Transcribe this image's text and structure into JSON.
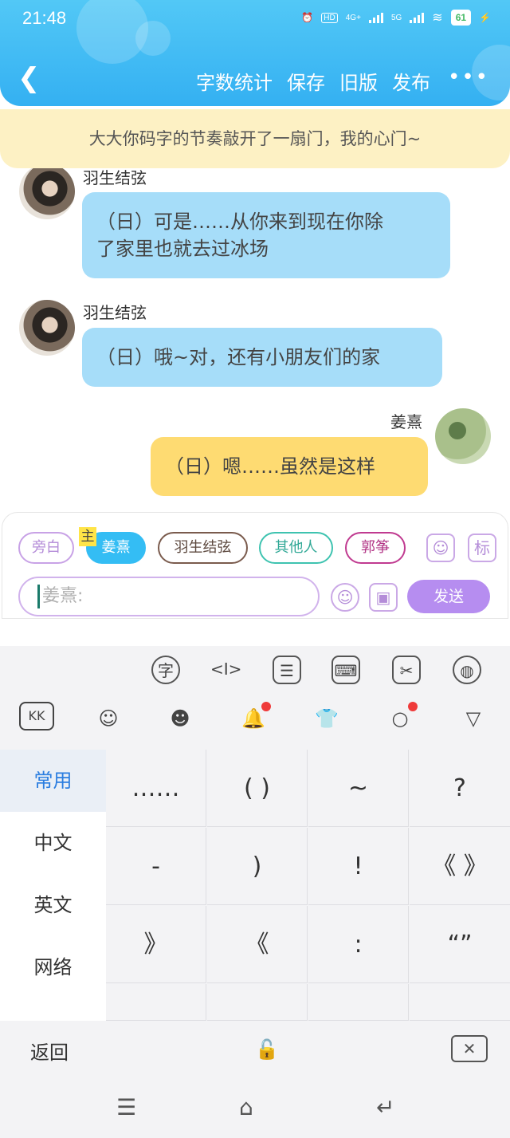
{
  "status_bar": {
    "time": "21:48",
    "network": "4G+",
    "network2": "5G",
    "battery": "61"
  },
  "nav": {
    "back_icon": "chevron-left-icon",
    "actions": [
      "字数统计",
      "保存",
      "旧版",
      "发布"
    ],
    "more": "•••"
  },
  "banner": {
    "text": "大大你码字的节奏敲开了一扇门，我的心门~"
  },
  "messages": [
    {
      "sender": "羽生结弦",
      "text_line1": "（日）可是……从你来到现在你除",
      "text_line2": "了家里也就去过冰场",
      "side": "left"
    },
    {
      "sender": "羽生结弦",
      "text_line1": "（日）哦~对，还有小朋友们的家",
      "side": "left"
    },
    {
      "sender": "姜熹",
      "text_line1": "（日）嗯……虽然是这样",
      "side": "right"
    }
  ],
  "roles": {
    "narration": "旁白",
    "main_tag": "主",
    "main": "姜熹",
    "yu": "羽生结弦",
    "other": "其他人",
    "guo": "郭筝",
    "role_icon_label": "标"
  },
  "compose": {
    "placeholder": "姜熹:",
    "send": "发送"
  },
  "keyboard": {
    "categories": [
      "常用",
      "中文",
      "英文",
      "网络"
    ],
    "symbols": [
      "……",
      "( )",
      "~",
      "?",
      "-",
      ")",
      "!",
      "《 》",
      "》",
      "《",
      ":",
      "“”"
    ],
    "back": "返回",
    "toolbar_row1": [
      "字",
      "<I>",
      "☰",
      "⌨",
      "✂",
      "◍"
    ],
    "toolbar_row2": [
      "KK",
      "☺",
      "☻",
      "🔔",
      "👕",
      "○",
      "▽"
    ]
  },
  "colors": {
    "header": "#34b0f2",
    "banner": "#fdf1c4",
    "left_bubble": "#a6ddf9",
    "right_bubble": "#fedb72",
    "send": "#b68df0"
  }
}
